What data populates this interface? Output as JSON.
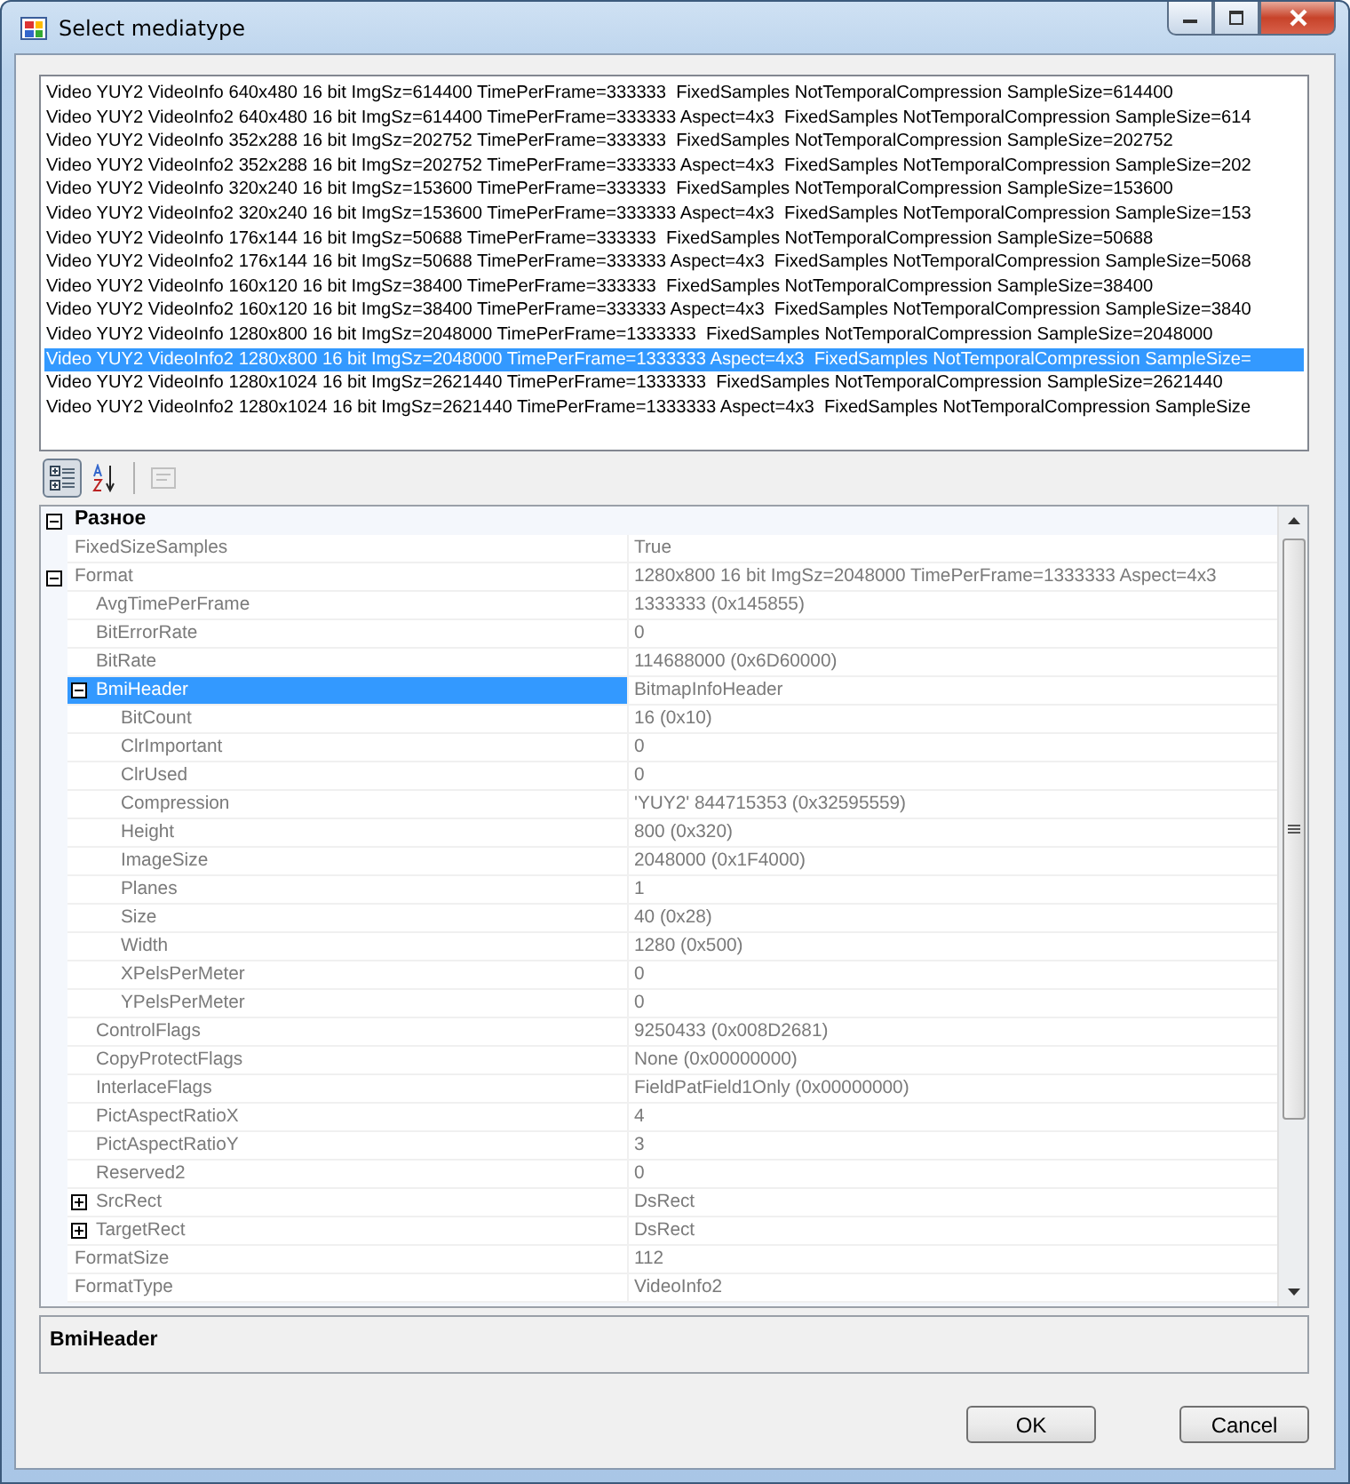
{
  "window": {
    "title": "Select mediatype"
  },
  "media_list": [
    {
      "text": "Video YUY2 VideoInfo 640x480 16 bit ImgSz=614400 TimePerFrame=333333  FixedSamples NotTemporalCompression SampleSize=614400",
      "selected": false
    },
    {
      "text": "Video YUY2 VideoInfo2 640x480 16 bit ImgSz=614400 TimePerFrame=333333 Aspect=4x3  FixedSamples NotTemporalCompression SampleSize=614",
      "selected": false
    },
    {
      "text": "Video YUY2 VideoInfo 352x288 16 bit ImgSz=202752 TimePerFrame=333333  FixedSamples NotTemporalCompression SampleSize=202752",
      "selected": false
    },
    {
      "text": "Video YUY2 VideoInfo2 352x288 16 bit ImgSz=202752 TimePerFrame=333333 Aspect=4x3  FixedSamples NotTemporalCompression SampleSize=202",
      "selected": false
    },
    {
      "text": "Video YUY2 VideoInfo 320x240 16 bit ImgSz=153600 TimePerFrame=333333  FixedSamples NotTemporalCompression SampleSize=153600",
      "selected": false
    },
    {
      "text": "Video YUY2 VideoInfo2 320x240 16 bit ImgSz=153600 TimePerFrame=333333 Aspect=4x3  FixedSamples NotTemporalCompression SampleSize=153",
      "selected": false
    },
    {
      "text": "Video YUY2 VideoInfo 176x144 16 bit ImgSz=50688 TimePerFrame=333333  FixedSamples NotTemporalCompression SampleSize=50688",
      "selected": false
    },
    {
      "text": "Video YUY2 VideoInfo2 176x144 16 bit ImgSz=50688 TimePerFrame=333333 Aspect=4x3  FixedSamples NotTemporalCompression SampleSize=5068",
      "selected": false
    },
    {
      "text": "Video YUY2 VideoInfo 160x120 16 bit ImgSz=38400 TimePerFrame=333333  FixedSamples NotTemporalCompression SampleSize=38400",
      "selected": false
    },
    {
      "text": "Video YUY2 VideoInfo2 160x120 16 bit ImgSz=38400 TimePerFrame=333333 Aspect=4x3  FixedSamples NotTemporalCompression SampleSize=3840",
      "selected": false
    },
    {
      "text": "Video YUY2 VideoInfo 1280x800 16 bit ImgSz=2048000 TimePerFrame=1333333  FixedSamples NotTemporalCompression SampleSize=2048000",
      "selected": false
    },
    {
      "text": "Video YUY2 VideoInfo2 1280x800 16 bit ImgSz=2048000 TimePerFrame=1333333 Aspect=4x3  FixedSamples NotTemporalCompression SampleSize=",
      "selected": true
    },
    {
      "text": "Video YUY2 VideoInfo 1280x1024 16 bit ImgSz=2621440 TimePerFrame=1333333  FixedSamples NotTemporalCompression SampleSize=2621440",
      "selected": false
    },
    {
      "text": "Video YUY2 VideoInfo2 1280x1024 16 bit ImgSz=2621440 TimePerFrame=1333333 Aspect=4x3  FixedSamples NotTemporalCompression SampleSize",
      "selected": false
    }
  ],
  "toolbar": [
    {
      "kind": "categorized",
      "selected": true
    },
    {
      "kind": "alphabetical",
      "selected": false
    },
    {
      "kind": "pages",
      "selected": false,
      "disabled": true
    }
  ],
  "property_grid": {
    "categories": [
      {
        "name": "Разное",
        "expanded": true,
        "properties": [
          {
            "name": "FixedSizeSamples",
            "value": "True",
            "selected": false
          },
          {
            "name": "Format",
            "value": "1280x800 16 bit ImgSz=2048000 TimePerFrame=1333333 Aspect=4x3",
            "selected": false,
            "expanded": true,
            "children": [
              {
                "name": "AvgTimePerFrame",
                "value": "1333333 (0x145855)",
                "selected": false
              },
              {
                "name": "BitErrorRate",
                "value": "0",
                "selected": false
              },
              {
                "name": "BitRate",
                "value": "114688000 (0x6D60000)",
                "selected": false
              },
              {
                "name": "BmiHeader",
                "value": "BitmapInfoHeader",
                "selected": true,
                "expanded": true,
                "children": [
                  {
                    "name": "BitCount",
                    "value": "16 (0x10)",
                    "selected": false
                  },
                  {
                    "name": "ClrImportant",
                    "value": "0",
                    "selected": false
                  },
                  {
                    "name": "ClrUsed",
                    "value": "0",
                    "selected": false
                  },
                  {
                    "name": "Compression",
                    "value": "'YUY2' 844715353 (0x32595559)",
                    "selected": false
                  },
                  {
                    "name": "Height",
                    "value": "800 (0x320)",
                    "selected": false
                  },
                  {
                    "name": "ImageSize",
                    "value": "2048000 (0x1F4000)",
                    "selected": false
                  },
                  {
                    "name": "Planes",
                    "value": "1",
                    "selected": false
                  },
                  {
                    "name": "Size",
                    "value": "40 (0x28)",
                    "selected": false
                  },
                  {
                    "name": "Width",
                    "value": "1280 (0x500)",
                    "selected": false
                  },
                  {
                    "name": "XPelsPerMeter",
                    "value": "0",
                    "selected": false
                  },
                  {
                    "name": "YPelsPerMeter",
                    "value": "0",
                    "selected": false
                  }
                ]
              },
              {
                "name": "ControlFlags",
                "value": "9250433 (0x008D2681)",
                "selected": false
              },
              {
                "name": "CopyProtectFlags",
                "value": "None (0x00000000)",
                "selected": false
              },
              {
                "name": "InterlaceFlags",
                "value": "FieldPatField1Only (0x00000000)",
                "selected": false
              },
              {
                "name": "PictAspectRatioX",
                "value": "4",
                "selected": false
              },
              {
                "name": "PictAspectRatioY",
                "value": "3",
                "selected": false
              },
              {
                "name": "Reserved2",
                "value": "0",
                "selected": false
              },
              {
                "name": "SrcRect",
                "value": "DsRect",
                "selected": false,
                "expanded": false
              },
              {
                "name": "TargetRect",
                "value": "DsRect",
                "selected": false,
                "expanded": false
              }
            ]
          },
          {
            "name": "FormatSize",
            "value": "112",
            "selected": false
          },
          {
            "name": "FormatType",
            "value": "VideoInfo2",
            "selected": false
          }
        ]
      }
    ]
  },
  "description": {
    "title": "BmiHeader"
  },
  "buttons": [
    "OK",
    "Cancel"
  ]
}
